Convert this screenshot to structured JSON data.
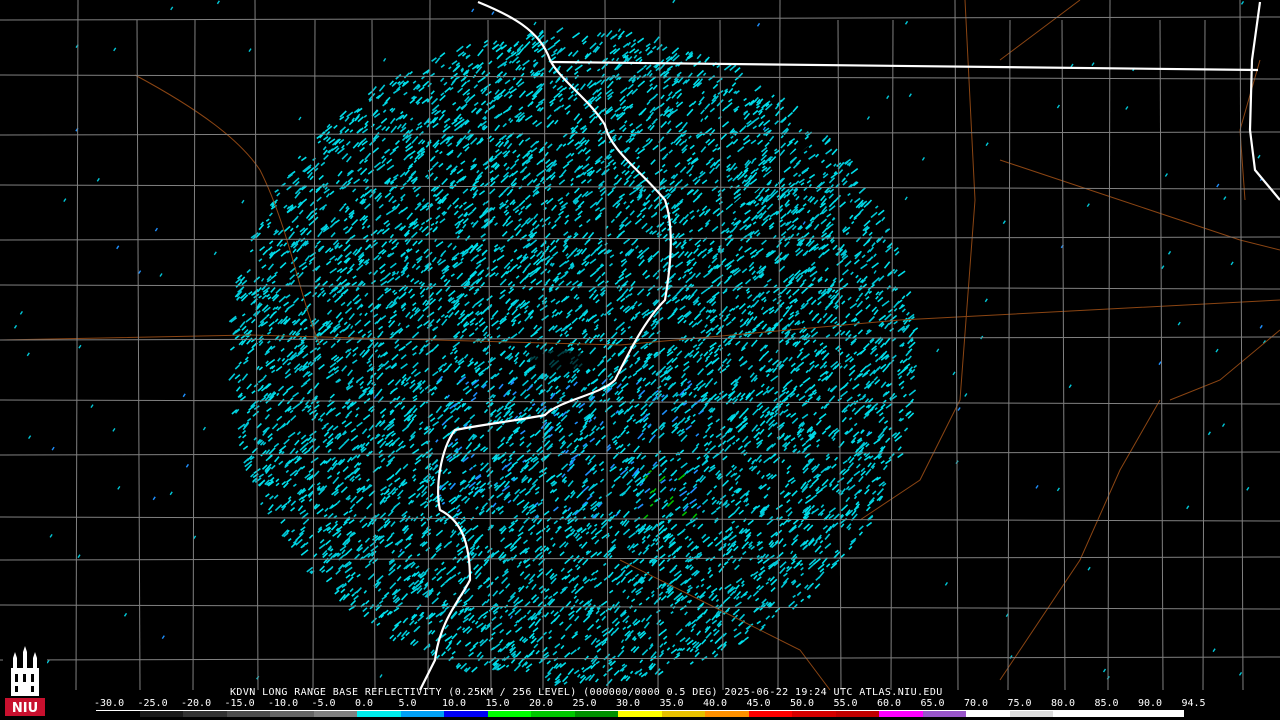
{
  "product_title": "KDVN LONG RANGE BASE REFLECTIVITY (0.25KM / 256 LEVEL) (000000/0000 0.5 DEG) 2025-06-22 19:24 UTC  ATLAS.NIU.EDU",
  "logo": {
    "text": "NIU",
    "icon": "niu-tower-icon",
    "color": "#c8102e"
  },
  "scale": {
    "labels": [
      "-30.0",
      "-25.0",
      "-20.0",
      "-15.0",
      "-10.0",
      "-5.0",
      "0.0",
      "5.0",
      "10.0",
      "15.0",
      "20.0",
      "25.0",
      "30.0",
      "35.0",
      "40.0",
      "45.0",
      "50.0",
      "55.0",
      "60.0",
      "65.0",
      "70.0",
      "75.0",
      "80.0",
      "85.0",
      "90.0",
      "94.5"
    ],
    "colors": [
      "#000000",
      "#1a1a1a",
      "#333333",
      "#4d4d4d",
      "#666666",
      "#808080",
      "#00ecec",
      "#01a0f6",
      "#0000f6",
      "#00ff00",
      "#00c800",
      "#009000",
      "#ffff00",
      "#e7c000",
      "#ff9000",
      "#ff0000",
      "#d60000",
      "#c00000",
      "#ff00ff",
      "#9955c9",
      "#ffffff",
      "#dddddd",
      "#ffffff",
      "#ffffff",
      "#ffffff"
    ]
  },
  "colors": {
    "county_lines": "#808080",
    "state_lines": "#ffffff",
    "roads": "#8b4513",
    "echo_main": "#00c8d8",
    "echo_light": "#00e0ec",
    "echo_blue": "#1e90ff",
    "echo_green": "#00c000"
  }
}
